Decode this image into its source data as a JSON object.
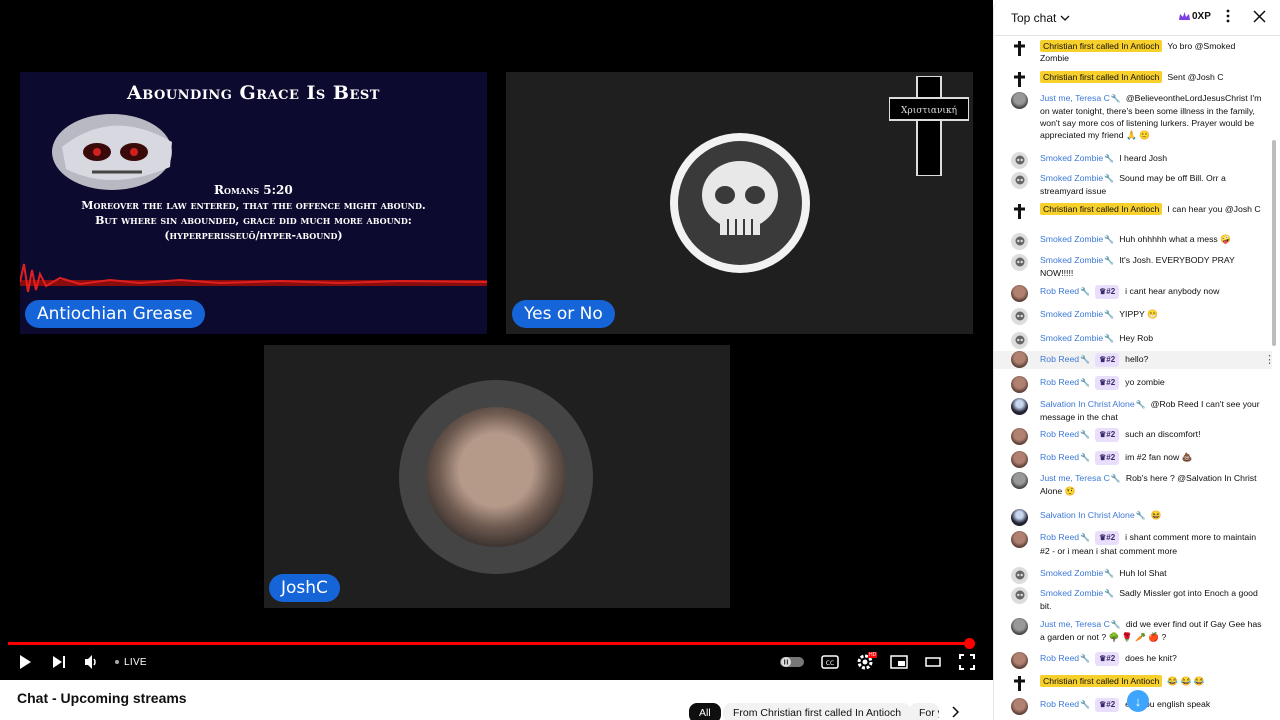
{
  "stream": {
    "tiles": [
      {
        "name": "Antiochian Grease"
      },
      {
        "name": "Yes or No"
      },
      {
        "name": "JoshC"
      }
    ],
    "slide": {
      "title": "Abounding Grace Is Best",
      "reference": "Romans 5:20",
      "lines": [
        "Moreover the law entered, that the offence might abound.",
        "But where sin abounded, grace did much more abound:",
        "(hyperperisseuō/hyper-abound)"
      ]
    },
    "cross_logo_text": "Χριστιανική",
    "controls": {
      "live_label": "LIVE",
      "progress": 1.0,
      "hd_badge": "HD"
    }
  },
  "below": {
    "title": "Chat - Upcoming streams",
    "chips": [
      "All",
      "From Christian first called In Antioch",
      "For y"
    ]
  },
  "chat": {
    "header": "Top chat",
    "xp": "0XP",
    "messages": [
      {
        "author": "Christian first called In Antioch",
        "type": "owner",
        "avatar": "cross",
        "text": "Yo bro @Smoked Zombie"
      },
      {
        "author": "Christian first called In Antioch",
        "type": "owner",
        "avatar": "cross",
        "text": "Sent @Josh C"
      },
      {
        "author": "Just me, Teresa C",
        "type": "mod",
        "avatar": "teresa",
        "text": "@BelieveontheLordJesusChrist I'm on water tonight, there's been some illness in the family, won't say more cos of listening lurkers. Prayer would be appreciated my friend 🙏 🙂"
      },
      {
        "author": "Smoked Zombie",
        "type": "mod",
        "avatar": "zombie",
        "text": "I heard Josh"
      },
      {
        "author": "Smoked Zombie",
        "type": "mod",
        "avatar": "zombie",
        "text": "Sound may be off Bill. Orr a streamyard issue"
      },
      {
        "author": "Christian first called In Antioch",
        "type": "owner",
        "avatar": "cross",
        "text": "I can hear you @Josh C"
      },
      {
        "author": "Smoked Zombie",
        "type": "mod",
        "avatar": "zombie",
        "text": "Huh ohhhhh what a mess 🤪"
      },
      {
        "author": "Smoked Zombie",
        "type": "mod",
        "avatar": "zombie",
        "text": "It's Josh. EVERYBODY PRAY NOW!!!!!"
      },
      {
        "author": "Rob Reed",
        "type": "mod",
        "rank": "#2",
        "avatar": "rob",
        "text": "i cant hear anybody now"
      },
      {
        "author": "Smoked Zombie",
        "type": "mod",
        "avatar": "zombie",
        "text": "YIPPY 😁"
      },
      {
        "author": "Smoked Zombie",
        "type": "mod",
        "avatar": "zombie",
        "text": "Hey Rob"
      },
      {
        "author": "Rob Reed",
        "type": "mod",
        "rank": "#2",
        "avatar": "rob",
        "text": "hello?"
      },
      {
        "author": "Rob Reed",
        "type": "mod",
        "rank": "#2",
        "avatar": "rob",
        "text": "yo zombie"
      },
      {
        "author": "Salvation In Christ Alone",
        "type": "mod",
        "avatar": "salv",
        "text": "@Rob Reed I can't see your message in the chat"
      },
      {
        "author": "Rob Reed",
        "type": "mod",
        "rank": "#2",
        "avatar": "rob",
        "text": "such an discomfort!"
      },
      {
        "author": "Rob Reed",
        "type": "mod",
        "rank": "#2",
        "avatar": "rob",
        "text": "im #2 fan now 💩"
      },
      {
        "author": "Just me, Teresa C",
        "type": "mod",
        "avatar": "teresa",
        "text": "Rob's here ? @Salvation In Christ Alone 🤨"
      },
      {
        "author": "Salvation In Christ Alone",
        "type": "mod",
        "avatar": "salv",
        "text": "😆"
      },
      {
        "author": "Rob Reed",
        "type": "mod",
        "rank": "#2",
        "avatar": "rob",
        "text": "i shant comment more to maintain #2 - or i mean i shat comment more"
      },
      {
        "author": "Smoked Zombie",
        "type": "mod",
        "avatar": "zombie",
        "text": "Huh lol Shat"
      },
      {
        "author": "Smoked Zombie",
        "type": "mod",
        "avatar": "zombie",
        "text": "Sadly Missler got into Enoch a good bit."
      },
      {
        "author": "Just me, Teresa C",
        "type": "mod",
        "avatar": "teresa",
        "text": "did we ever find out if Gay Gee has a garden or not ? 🌳 🌹 🥕 🍎 ?"
      },
      {
        "author": "Rob Reed",
        "type": "mod",
        "rank": "#2",
        "avatar": "rob",
        "text": "does he knit?"
      },
      {
        "author": "Christian first called In Antioch",
        "type": "owner",
        "avatar": "cross",
        "text": "😂 😂 😂"
      },
      {
        "author": "Rob Reed",
        "type": "mod",
        "rank": "#2",
        "avatar": "rob",
        "text": "er - you english speak"
      }
    ]
  }
}
